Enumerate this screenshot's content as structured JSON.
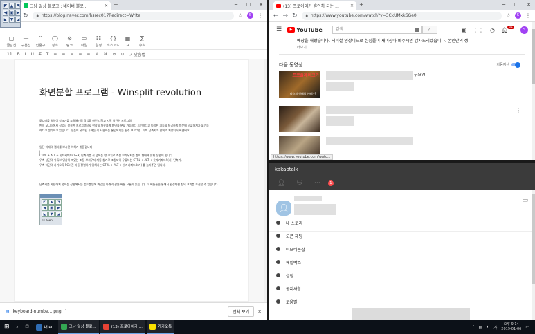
{
  "naver_window": {
    "tab_title": "그냥 일상 블로그 : 네이버 블로...",
    "url": "https://blog.naver.com/hsrec017Redirect=Write",
    "account_initial": "S",
    "toolbar": [
      {
        "icon": "▢",
        "label": "글감신"
      },
      {
        "icon": "—",
        "label": "구분선"
      },
      {
        "icon": "“",
        "label": "인용구"
      },
      {
        "icon": "◯",
        "label": "장소"
      },
      {
        "icon": "⊘",
        "label": "링크"
      },
      {
        "icon": "▭",
        "label": "파일"
      },
      {
        "icon": "☷",
        "label": "일정"
      },
      {
        "icon": "{}",
        "label": "소스코드"
      },
      {
        "icon": "▦",
        "label": "표"
      },
      {
        "icon": "∑",
        "label": "수식"
      }
    ],
    "format_bar": [
      "11",
      "B",
      "I",
      "U",
      "T̶",
      "T",
      "≡",
      "≡",
      "≡",
      "≡",
      "≡",
      "⇕",
      "⌘",
      "⊘",
      "⊙",
      "✓ 맞춤법"
    ],
    "post_title": "화면분할 프로그램 - Winsplit revolution",
    "paragraph1_line1": "모니터를 일일이 창크기를 조절해가며 작업을 하던 대학교 시절 발견한 프로그램.",
    "paragraph1_line2": "만일 모니터에서 작업시 유용한 프로그램으로 한창을 자유롭게 화면을 분할 가능하다 드린하다고 다양한 기능을 제공하지 때문에 비교하게가 불가능",
    "paragraph1_line3": "하다고 생각하고 있습니다. 정품이 유가된 후에는 꼭 사용하는 본인에게는 필수 프로그램. 이미 단축키가 단위로 지정되어 버렸어요.",
    "paragraph2_line1": "일단 아래의 캡쳐를 보시면 이해가 쉬울겁니다",
    "paragraph2_line2": "CTRL + ALT + 숫자키패드(1~9) 단축키를 꼭 옆에는 반 크기로 조절 브라우저를 창의 형태에 맞춰 정렬해 줍니다.",
    "paragraph2_line3": "우측 상단의 유튜브 영상이 떠있는 조절 브라우저 자동 창기로 조절되어 유튜브는 CTRL + ALT + 숫자키패드9(키) 단축키,",
    "paragraph2_line4": "우측 하단의 카카오톡 PC버전 자동 정렬하기 위해서는 CTRL + ALT + 숫자키패드3(키) 를 눌러주면 됩니다.",
    "paragraph3": "단축키를 사용하지 못하는 상황에서는 컨트롤팁에 떠있는 아래의 같은 버튼 모듈이 있습니다. 이 버튼들을 통해서 활성화된 창의 크기를 조절할 수 있습니다.",
    "keep_label": "Keep",
    "download_filename": "keyboard-numbe....png",
    "show_all": "전체 보기"
  },
  "winsplit_arrows": [
    "◤",
    "▲",
    "◥",
    "◀",
    "▣",
    "▶",
    "◣",
    "▼",
    "◢"
  ],
  "youtube_window": {
    "tab_title": "(13) 프로아이가 혼인하 되는 ...",
    "url": "https://www.youtube.com/watch?v=3CkUMxk6Ge0",
    "logo_text": "YouTube",
    "search_placeholder": "검색",
    "notification_count": "9+",
    "account_initial": "S",
    "description": "예상을 해봤습니다. 뇌피셜 영상이므로 심심풀이 재미상아 봐주시면 감사드리겠습니다. 본인만의 생",
    "more": "더보기",
    "up_next": "다음 동영상",
    "autoplay": "자동재생",
    "video1_suffix": "구요?!",
    "video1_overlay_top": "프로플레이크가",
    "video1_overlay_bottom": "타스의 선배의 선배는?",
    "status_url": "https://www.youtube.com/watc..."
  },
  "kakao_window": {
    "title": "kakaotalk",
    "badge_count": "1",
    "menu_items": [
      "내 스토리",
      "오픈 채팅",
      "이모티콘샵",
      "페밀박스",
      "설정",
      "공지사항",
      "도움말"
    ]
  },
  "taskbar": {
    "items": [
      {
        "label": "내 PC",
        "color": "#2f6db5"
      },
      {
        "label": "그냥 일상 블로...",
        "color": "#34a853"
      },
      {
        "label": "(13) 프로아이가 ...",
        "color": "#ea4335"
      },
      {
        "label": "카카오톡",
        "color": "#fae100"
      }
    ],
    "time": "오후 9:14",
    "date": "2019-01-06"
  },
  "colors": {
    "taskbar": "#0c1118",
    "kakao_header": "#3b3b3b",
    "youtube_red": "#ff0000",
    "accent": "#1a73e8"
  }
}
